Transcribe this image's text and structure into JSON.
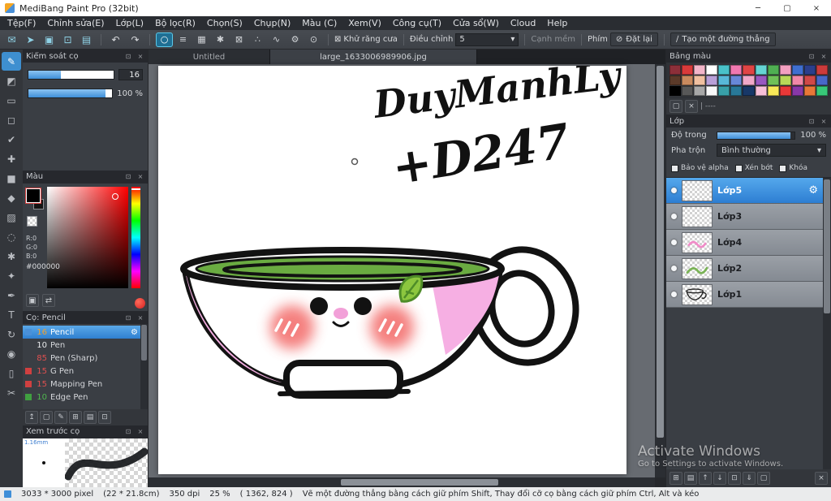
{
  "window": {
    "title": "MediBang Paint Pro (32bit)"
  },
  "titlebar": {
    "minimize": "─",
    "maximize": "▢",
    "close": "×"
  },
  "panel_icons": {
    "popout": "⊡",
    "close": "×"
  },
  "menubar": {
    "items": [
      "Tệp(F)",
      "Chỉnh sửa(E)",
      "Lớp(L)",
      "Bộ lọc(R)",
      "Chọn(S)",
      "Chụp(N)",
      "Màu (C)",
      "Xem(V)",
      "Công cụ(T)",
      "Cửa sổ(W)",
      "Cloud",
      "Help"
    ]
  },
  "toolbar": {
    "quick_icons": [
      {
        "name": "cloud-chat-icon",
        "glyph": "✉"
      },
      {
        "name": "publish-icon",
        "glyph": "➤"
      },
      {
        "name": "palette-icon",
        "glyph": "▣"
      },
      {
        "name": "copy-work-icon",
        "glyph": "⊡"
      },
      {
        "name": "material-icon",
        "glyph": "▤"
      }
    ],
    "undo": {
      "name": "undo-icon",
      "glyph": "↶"
    },
    "redo": {
      "name": "redo-icon",
      "glyph": "↷"
    },
    "option_icons": [
      {
        "name": "ellipse-option-icon",
        "glyph": "○",
        "selected": true
      },
      {
        "name": "stripes-option-icon",
        "glyph": "≡",
        "selected": false
      },
      {
        "name": "grid-option-icon",
        "glyph": "▦",
        "selected": false
      },
      {
        "name": "burst-option-icon",
        "glyph": "✱",
        "selected": false
      },
      {
        "name": "crosshatch-option-icon",
        "glyph": "⊠",
        "selected": false
      },
      {
        "name": "scatter-option-icon",
        "glyph": "∴",
        "selected": false
      },
      {
        "name": "curve-option-icon",
        "glyph": "∿",
        "selected": false
      },
      {
        "name": "settings-option-icon",
        "glyph": "⚙",
        "selected": false
      },
      {
        "name": "target-option-icon",
        "glyph": "⊙",
        "selected": false
      }
    ],
    "antialias_icon": "⊠",
    "antialias_label": "Khử răng cưa",
    "adjust_label": "Điều chỉnh",
    "adjust_value": "5",
    "soft_edge_label": "Cạnh mềm",
    "key_label": "Phím",
    "reset_icon": "⊘",
    "reset_label": "Đặt lại",
    "line_icon": "∕",
    "line_label": "Tạo một đường thẳng"
  },
  "tool_strip": [
    {
      "name": "brush-tool",
      "glyph": "✎",
      "selected": true
    },
    {
      "name": "eraser-tool",
      "glyph": "◩",
      "selected": false
    },
    {
      "name": "stamp-tool",
      "glyph": "▭",
      "selected": false
    },
    {
      "name": "select-rect-tool",
      "glyph": "◻",
      "selected": false
    },
    {
      "name": "check-brush-tool",
      "glyph": "✔",
      "selected": false
    },
    {
      "name": "move-tool",
      "glyph": "✚",
      "selected": false
    },
    {
      "name": "fill-rect-tool",
      "glyph": "■",
      "selected": false
    },
    {
      "name": "bucket-tool",
      "glyph": "◆",
      "selected": false
    },
    {
      "name": "gradient-tool",
      "glyph": "▨",
      "selected": false
    },
    {
      "name": "lasso-tool",
      "glyph": "◌",
      "selected": false
    },
    {
      "name": "magic-wand-tool",
      "glyph": "✱",
      "selected": false
    },
    {
      "name": "operation-tool",
      "glyph": "✦",
      "selected": false
    },
    {
      "name": "pen-tool",
      "glyph": "✒",
      "selected": false
    },
    {
      "name": "text-tool",
      "glyph": "T",
      "selected": false
    },
    {
      "name": "rotate-tool",
      "glyph": "↻",
      "selected": false
    },
    {
      "name": "eyedropper-tool",
      "glyph": "◉",
      "selected": false
    },
    {
      "name": "divide-tool",
      "glyph": "▯",
      "selected": false
    },
    {
      "name": "scissors-tool",
      "glyph": "✂",
      "selected": false
    }
  ],
  "brush_control": {
    "title": "Kiểm soát cọ",
    "size_value": "16",
    "opacity_value": "100 %"
  },
  "color_panel": {
    "title": "Màu",
    "r": "R:0",
    "g": "G:0",
    "b": "B:0",
    "hex": "#000000",
    "icons": [
      {
        "name": "add-palette-color-icon",
        "glyph": "▣"
      },
      {
        "name": "swap-color-icon",
        "glyph": "⇄"
      }
    ]
  },
  "brush_panel": {
    "title": "Cọ: Pencil",
    "brushes": [
      {
        "size": "16",
        "name": "Pencil",
        "size_color": "#f0a030",
        "chip": "#4a90d8",
        "selected": true
      },
      {
        "size": "10",
        "name": "Pen",
        "size_color": "#e8eaec",
        "chip": "",
        "selected": false
      },
      {
        "size": "85",
        "name": "Pen (Sharp)",
        "size_color": "#e05050",
        "chip": "",
        "selected": false
      },
      {
        "size": "15",
        "name": "G Pen",
        "size_color": "#e05050",
        "chip": "#d04040",
        "selected": false
      },
      {
        "size": "15",
        "name": "Mapping Pen",
        "size_color": "#e05050",
        "chip": "#d04040",
        "selected": false
      },
      {
        "size": "10",
        "name": "Edge Pen",
        "size_color": "#50b850",
        "chip": "#40a040",
        "selected": false
      }
    ],
    "gear_icon": "⚙",
    "footer_icons": [
      {
        "name": "upload-brush-icon",
        "glyph": "↥"
      },
      {
        "name": "new-brush-icon",
        "glyph": "▢"
      },
      {
        "name": "edit-brush-icon",
        "glyph": "✎"
      },
      {
        "name": "duplicate-brush-icon",
        "glyph": "⊞"
      },
      {
        "name": "brush-folder-icon",
        "glyph": "▤"
      },
      {
        "name": "copy-brush-icon",
        "glyph": "⊡"
      }
    ]
  },
  "preview_panel": {
    "title": "Xem trước cọ",
    "size_label": "1.16mm"
  },
  "tabs": [
    {
      "label": "Untitled",
      "active": false
    },
    {
      "label": "large_1633006989906.jpg",
      "active": true
    }
  ],
  "canvas": {
    "handwriting_line1": "DuyManhLy",
    "handwriting_line2": "+D247",
    "colors": {
      "rim_green": "#6aab41",
      "patch_pink": "#f6afe3",
      "cheek_pink": "#f2615e",
      "leaf_green": "#8cc63f",
      "nose_pink": "#f2a0d8"
    }
  },
  "palette_panel": {
    "title": "Bảng màu",
    "swatches": [
      "#8c2f39",
      "#d93a3a",
      "#f2b5c9",
      "#ffffff",
      "#49c2c9",
      "#f078b0",
      "#e04545",
      "#65d4d4",
      "#4fae52",
      "#f2a0c0",
      "#3f6fd0",
      "#2b3f8c",
      "#cc3b3b",
      "#5b3a29",
      "#c98a5e",
      "#f0c0a0",
      "#b8a0d8",
      "#58b8d8",
      "#6888d8",
      "#f0a8c8",
      "#9858c0",
      "#70c058",
      "#b8d858",
      "#f088a8",
      "#d04848",
      "#4868c8",
      "#000000",
      "#585858",
      "#a8a8a8",
      "#f8f8f8",
      "#38a0a8",
      "#287898",
      "#183868",
      "#f8c0d8",
      "#f8e858",
      "#e83838",
      "#8838a8",
      "#e87838",
      "#38c878"
    ],
    "footer_icons": [
      {
        "name": "new-color-icon",
        "glyph": "▢"
      },
      {
        "name": "delete-color-icon",
        "glyph": "×"
      }
    ],
    "footer_label": "| ----"
  },
  "layers_panel": {
    "title": "Lớp",
    "opacity_label": "Độ trong",
    "opacity_value": "100 %",
    "blend_label": "Pha trộn",
    "blend_value": "Bình thường",
    "dropdown_arrow": "▾",
    "checkboxes": [
      {
        "name": "protect-alpha-checkbox",
        "label": "Bảo vệ alpha",
        "checked": false
      },
      {
        "name": "clipping-checkbox",
        "label": "Xén bớt",
        "checked": false
      },
      {
        "name": "lock-checkbox",
        "label": "Khóa",
        "checked": false
      }
    ],
    "gear_icon": "⚙",
    "layers": [
      {
        "name": "Lớp5",
        "selected": true,
        "thumb": "empty"
      },
      {
        "name": "Lớp3",
        "selected": false,
        "thumb": "empty"
      },
      {
        "name": "Lớp4",
        "selected": false,
        "thumb": "pink"
      },
      {
        "name": "Lớp2",
        "selected": false,
        "thumb": "green"
      },
      {
        "name": "Lớp1",
        "selected": false,
        "thumb": "cup"
      }
    ],
    "footer_icons": [
      {
        "name": "new-layer-icon",
        "glyph": "⊞"
      },
      {
        "name": "new-folder-icon",
        "glyph": "▤"
      },
      {
        "name": "layer-up-icon",
        "glyph": "↑"
      },
      {
        "name": "layer-down-icon",
        "glyph": "↓"
      },
      {
        "name": "duplicate-layer-icon",
        "glyph": "⊡"
      },
      {
        "name": "merge-down-icon",
        "glyph": "⇓"
      },
      {
        "name": "clear-layer-icon",
        "glyph": "▢"
      }
    ],
    "trash_icon": {
      "name": "delete-layer-icon",
      "glyph": "×"
    }
  },
  "statusbar": {
    "segments": [
      "3033 * 3000 pixel",
      "(22 * 21.8cm)",
      "350 dpi",
      "25 %",
      "( 1362, 824 )"
    ],
    "hint": "Vẽ một đường thẳng bằng cách giữ phím Shift, Thay đổi cỡ cọ bằng cách giữ phím Ctrl, Alt và kéo"
  },
  "watermark": {
    "line1": "Activate Windows",
    "line2": "Go to Settings to activate Windows."
  }
}
